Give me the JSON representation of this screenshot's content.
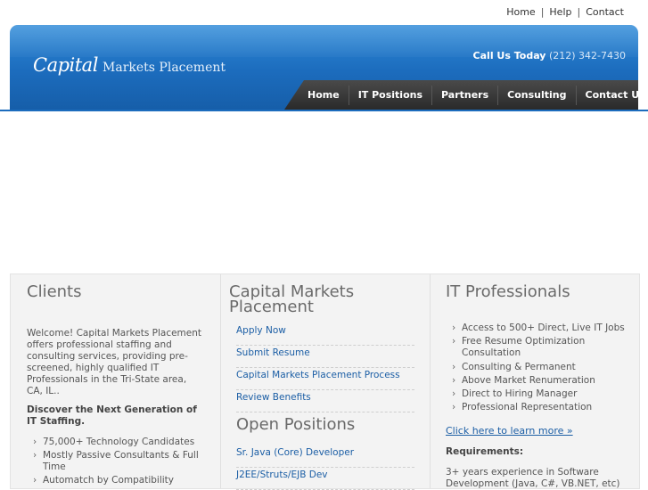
{
  "top_links": {
    "home": "Home",
    "help": "Help",
    "contact": "Contact",
    "separator": "|"
  },
  "header": {
    "logo_capital": "Capital",
    "logo_rest": "Markets Placement",
    "call_label": "Call Us Today",
    "phone": "(212) 342-7430"
  },
  "nav": [
    "Home",
    "IT Positions",
    "Partners",
    "Consulting",
    "Contact Us"
  ],
  "clients": {
    "title": "Clients",
    "intro": "Welcome! Capital Markets Placement offers professional staffing and consulting services, providing pre-screened, highly qualified IT Professionals in the Tri-State area, CA, IL..",
    "subhead": "Discover the Next Generation of IT Staffing.",
    "bullets": [
      "75,000+ Technology Candidates",
      "Mostly Passive Consultants & Full Time",
      "Automatch by Compatibility"
    ]
  },
  "cmp": {
    "title": "Capital Markets Placement",
    "links": [
      "Apply Now",
      "Submit Resume",
      "Capital Markets Placement Process",
      "Review Benefits"
    ],
    "open_positions_title": "Open Positions",
    "positions": [
      "Sr. Java (Core) Developer",
      "J2EE/Struts/EJB Dev"
    ]
  },
  "it_pros": {
    "title": "IT Professionals",
    "bullets": [
      "Access to 500+ Direct, Live IT Jobs",
      "Free Resume Optimization Consultation",
      "Consulting & Permanent",
      "Above Market Renumeration",
      "Direct to Hiring Manager",
      "Professional Representation"
    ],
    "learn_more": "Click here to learn more »",
    "req_label": "Requirements:",
    "req_text": "3+ years experience in Software Development (Java, C#, VB.NET, etc)"
  },
  "colors": {
    "header_blue": "#1c6cbd",
    "nav_dark": "#333333",
    "link_blue": "#1b5ea5"
  }
}
